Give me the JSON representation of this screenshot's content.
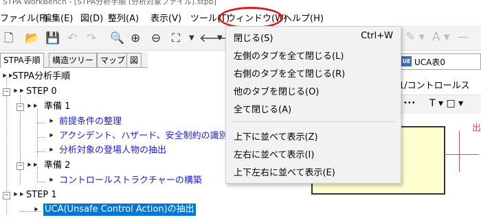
{
  "window": {
    "title": "STPA WorkBench - [STPA分析手順 (分析対象ファイル).stpb]"
  },
  "menubar": [
    "ファイル(F)",
    "編集(E)",
    "図(D)",
    "整列(A)",
    "表示(V)",
    "ツール(T)",
    "ウィンドウ(W)",
    "ヘルプ(H)"
  ],
  "window_menu": {
    "items": [
      {
        "label": "閉じる(S)",
        "shortcut": "Ctrl+W"
      },
      {
        "label": "左側のタブを全て閉じる(L)",
        "shortcut": ""
      },
      {
        "label": "右側のタブを全て閉じる(R)",
        "shortcut": ""
      },
      {
        "label": "他のタブを閉じる(O)",
        "shortcut": ""
      },
      {
        "label": "全て閉じる(A)",
        "shortcut": ""
      },
      {
        "label": "上下に並べて表示(Z)",
        "shortcut": ""
      },
      {
        "label": "左右に並べて表示(I)",
        "shortcut": ""
      },
      {
        "label": "上下左右に並べて表示(E)",
        "shortcut": ""
      }
    ]
  },
  "left_tabs": [
    "STPA手順",
    "構造ツリー",
    "マップ",
    "図"
  ],
  "tree": {
    "root": "STPA分析手順",
    "step0": "STEP 0",
    "prep1": "準備 1",
    "prep1_items": [
      "前提条件の整理",
      "アクシデント、ハザード、安全制約の識別",
      "分析対象の登場人物の抽出"
    ],
    "prep2": "準備 2",
    "prep2_items": [
      "コントロールストラクチャーの構築"
    ],
    "step1": "STEP 1",
    "step1_items": [
      "UCA(Unsafe Control Action)の抽出"
    ]
  },
  "right_panel": {
    "tab_icon": "UE",
    "tab_label": "UCA表0",
    "breadcrumb": "1/コントロールス",
    "format_text_tool": "T ▾ □ ▾",
    "format_dots": "•••",
    "side_text": "出"
  },
  "colors": {
    "highlight": "#e0191c",
    "link_blue": "#1a1adb",
    "selection": "#0078d7",
    "menu_bg": "#f2f2f2"
  }
}
